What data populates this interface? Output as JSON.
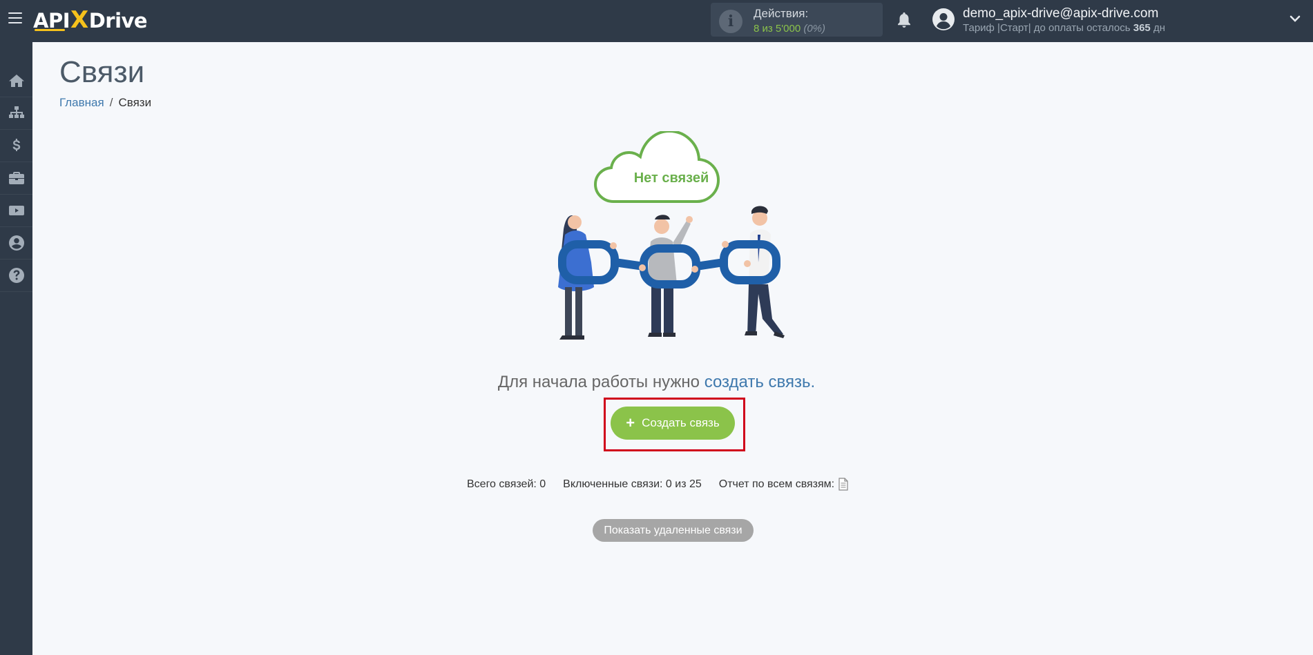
{
  "header": {
    "logo": {
      "api": "API",
      "x": "X",
      "drive": "Drive"
    },
    "actions": {
      "label": "Действия:",
      "count": "8 из 5'000",
      "percent": "(0%)"
    },
    "user": {
      "email": "demo_apix-drive@apix-drive.com",
      "plan_prefix": "Тариф |Старт| до оплаты осталось",
      "days": "365",
      "days_suffix": "дн"
    }
  },
  "sidebar": {
    "items": [
      {
        "icon": "home-icon"
      },
      {
        "icon": "sitemap-icon"
      },
      {
        "icon": "dollar-icon"
      },
      {
        "icon": "briefcase-icon"
      },
      {
        "icon": "youtube-icon"
      },
      {
        "icon": "user-circle-icon"
      },
      {
        "icon": "question-icon"
      }
    ]
  },
  "page": {
    "title": "Связи",
    "breadcrumb": {
      "home": "Главная",
      "separator": "/",
      "current": "Связи"
    },
    "illustration_cloud_text": "Нет связей",
    "empty_text": "Для начала работы нужно",
    "empty_link": "создать связь.",
    "create_button": "Создать связь",
    "stats": {
      "total": "Всего связей: 0",
      "enabled": "Включенные связи: 0 из 25",
      "report": "Отчет по всем связям:"
    },
    "show_deleted": "Показать удаленные связи"
  },
  "colors": {
    "topbar": "#2f3a48",
    "accent_green": "#8bc34a",
    "link_blue": "#3f79ad",
    "highlight_red": "#d0021b",
    "chain_blue": "#1f5fa8"
  }
}
